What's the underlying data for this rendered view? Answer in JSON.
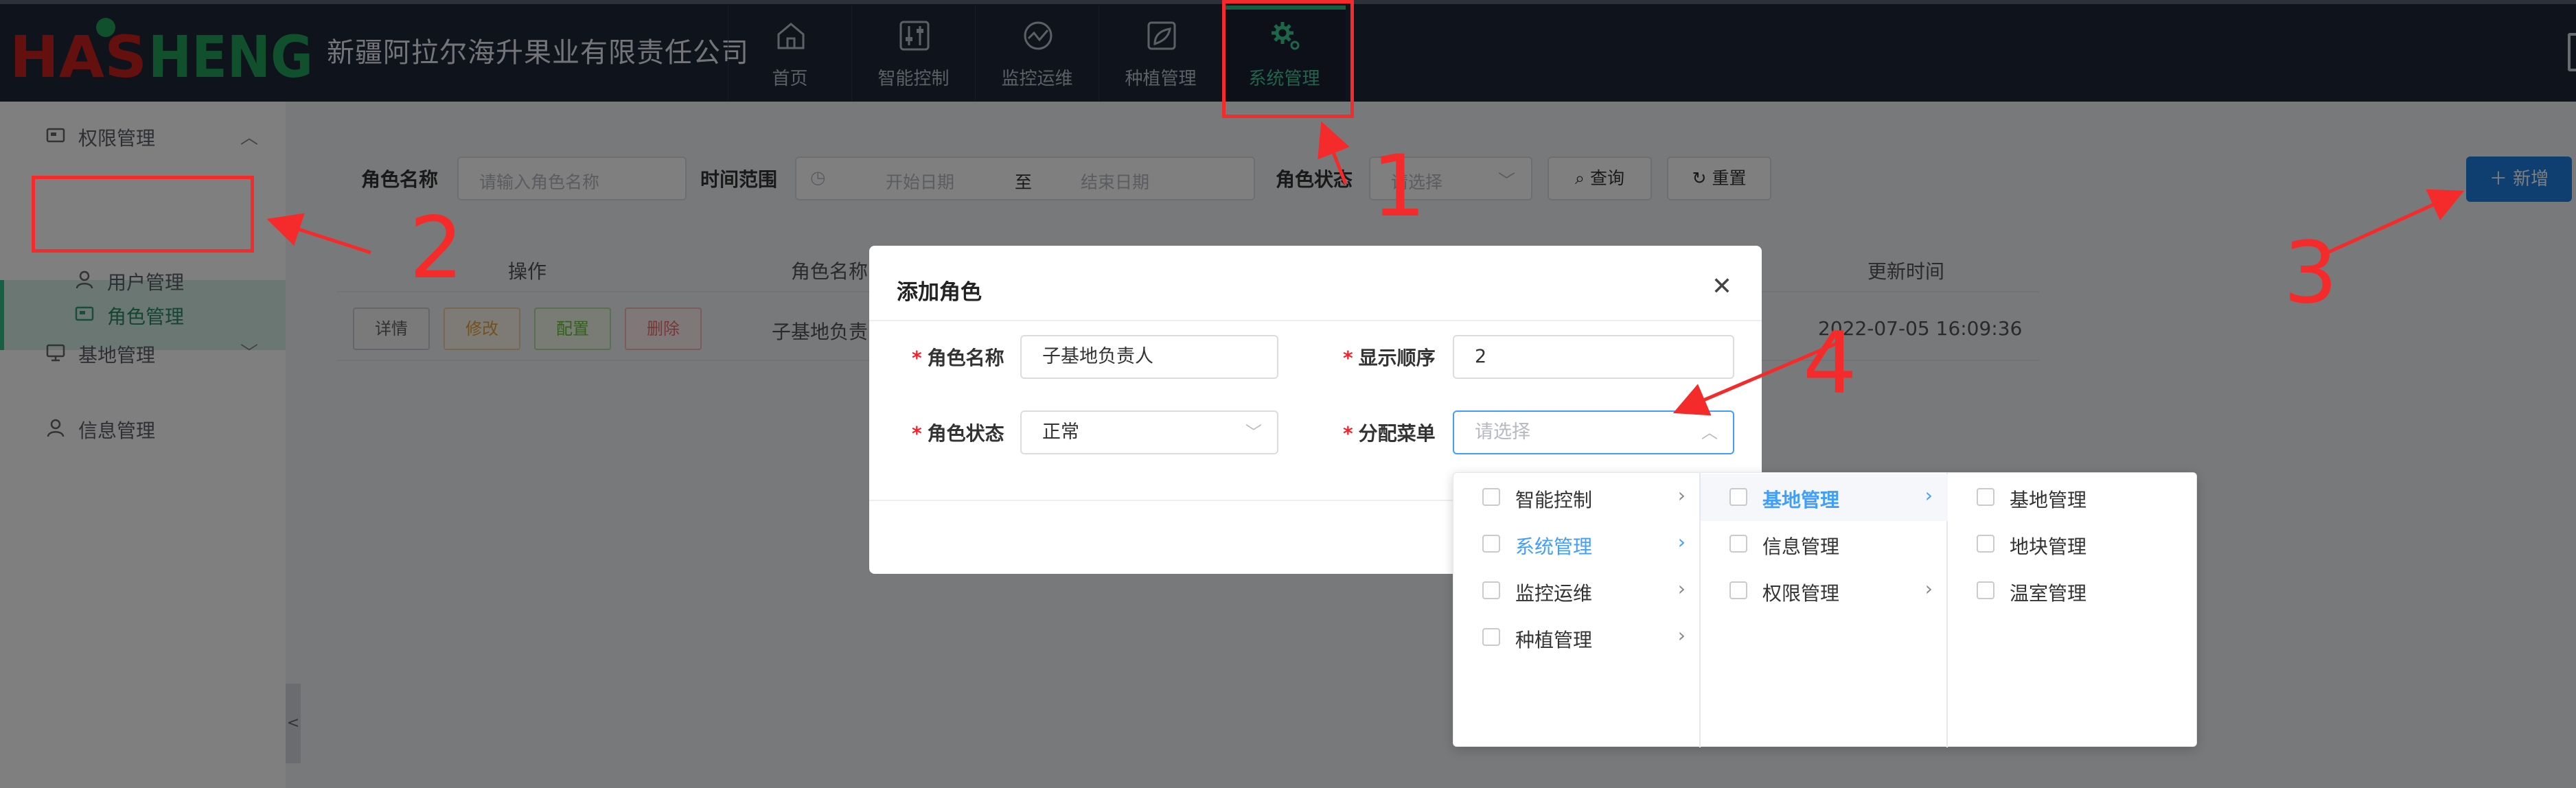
{
  "header": {
    "logo_text": "HASHENG",
    "company": "新疆阿拉尔海升果业有限责任公司",
    "nav": [
      {
        "label": "首页",
        "icon": "home-icon"
      },
      {
        "label": "智能控制",
        "icon": "control-panel-icon"
      },
      {
        "label": "监控运维",
        "icon": "monitor-icon"
      },
      {
        "label": "种植管理",
        "icon": "plant-icon"
      },
      {
        "label": "系统管理",
        "icon": "settings-gear-icon"
      }
    ],
    "active_nav": "系统管理"
  },
  "sidebar": {
    "groups": [
      {
        "label": "权限管理",
        "icon": "permission-icon",
        "expanded": true,
        "children": [
          {
            "label": "角色管理",
            "icon": "role-icon",
            "active": true
          },
          {
            "label": "用户管理",
            "icon": "user-icon"
          }
        ]
      },
      {
        "label": "基地管理",
        "icon": "base-icon",
        "expanded": false
      },
      {
        "label": "信息管理",
        "icon": "info-user-icon"
      }
    ]
  },
  "filters": {
    "role_name_label": "角色名称",
    "role_name_placeholder": "请输入角色名称",
    "time_range_label": "时间范围",
    "start_placeholder": "开始日期",
    "range_separator": "至",
    "end_placeholder": "结束日期",
    "role_status_label": "角色状态",
    "role_status_placeholder": "请选择",
    "query_button": "查询",
    "reset_button": "重置",
    "add_button": "新增"
  },
  "table": {
    "headers": [
      "操作",
      "角色名称",
      "更新时间"
    ],
    "rows": [
      {
        "actions": [
          "详情",
          "修改",
          "配置",
          "删除"
        ],
        "role_name": "子基地负责",
        "updated": "2022-07-05 16:09:36"
      }
    ]
  },
  "modal": {
    "title": "添加角色",
    "fields": {
      "role_name_label": "角色名称",
      "role_name_value": "子基地负责人",
      "display_order_label": "显示顺序",
      "display_order_value": "2",
      "role_status_label": "角色状态",
      "role_status_value": "正常",
      "assign_menu_label": "分配菜单",
      "assign_menu_placeholder": "请选择"
    }
  },
  "cascader": {
    "col1": [
      "智能控制",
      "系统管理",
      "监控运维",
      "种植管理"
    ],
    "col1_selected": "系统管理",
    "col2": [
      "基地管理",
      "信息管理",
      "权限管理"
    ],
    "col2_selected": "基地管理",
    "col3": [
      "基地管理",
      "地块管理",
      "温室管理"
    ]
  },
  "annotations": [
    "1",
    "2",
    "3",
    "4"
  ],
  "colors": {
    "header_bg": "#1f2638",
    "accent_green": "#2fbf87",
    "primary_blue": "#1f7fe0",
    "annotation_red": "#f52b2b"
  }
}
